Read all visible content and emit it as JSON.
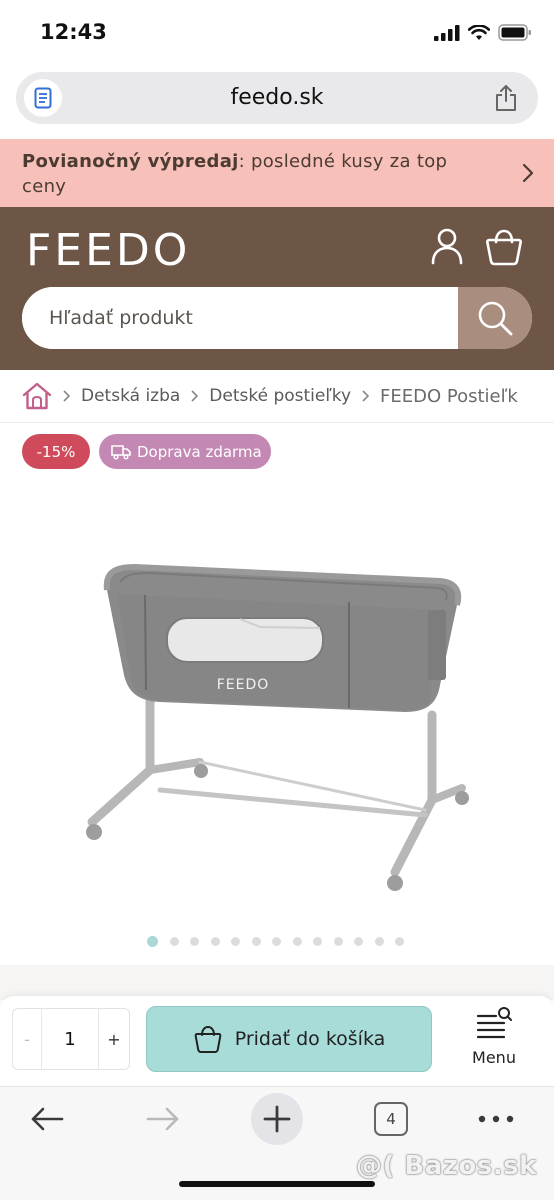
{
  "status_bar": {
    "time": "12:43"
  },
  "browser": {
    "url": "feedo.sk",
    "open_tabs": "4"
  },
  "promo": {
    "bold": "Povianočný výpredaj",
    "rest": ": posledné kusy za top ceny"
  },
  "header": {
    "logo": "FEEDO",
    "search_placeholder": "Hľadať produkt"
  },
  "breadcrumb": {
    "items": [
      "Detská izba",
      "Detské postieľky"
    ],
    "current": "FEEDO Postieľk"
  },
  "badges": {
    "discount": "-15%",
    "shipping": "Doprava zdarma"
  },
  "product": {
    "image_brand": "FEEDO",
    "slide_count": 13,
    "active_slide": 1
  },
  "cart_bar": {
    "quantity": "1",
    "minus": "-",
    "plus": "+",
    "add_to_cart": "Pridať do košíka",
    "menu": "Menu"
  },
  "watermark": "@( Bazos.sk",
  "colors": {
    "brand": "#6e5647",
    "promo": "#f7c1b9",
    "accent": "#a7dcd8",
    "discount": "#cf4b5b",
    "shipping": "#c389b4",
    "search_button": "#a98e7f"
  }
}
